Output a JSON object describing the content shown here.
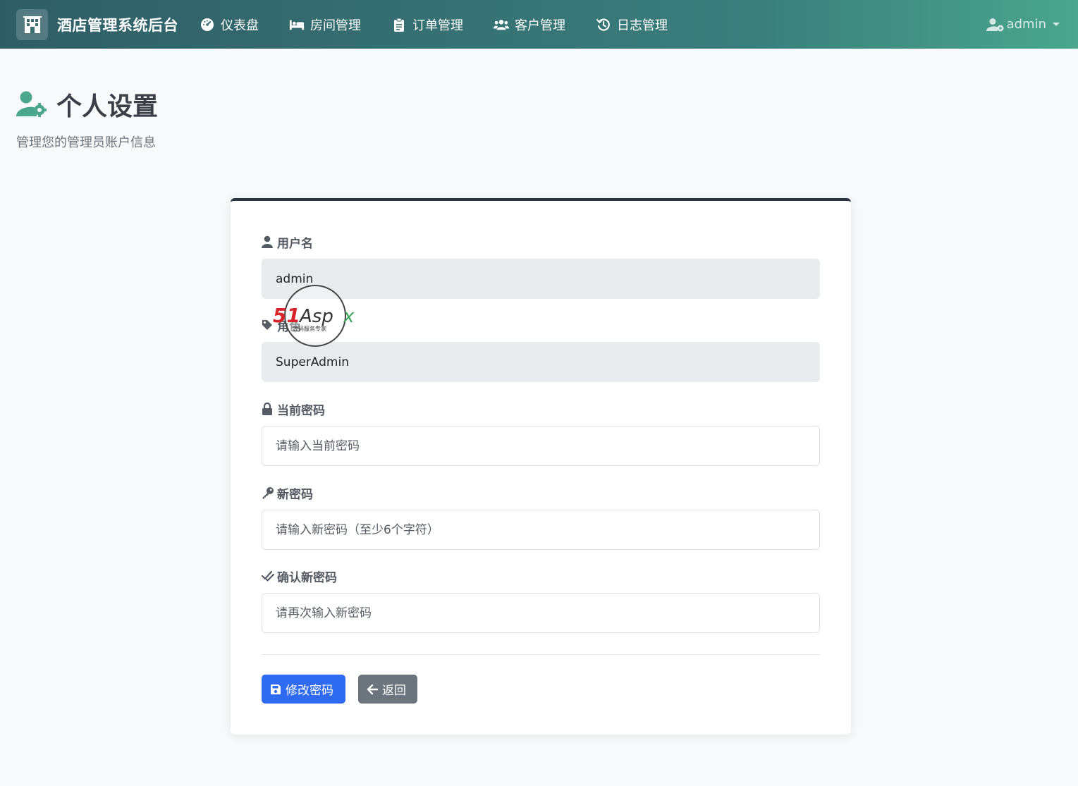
{
  "navbar": {
    "brand_title": "酒店管理系统后台",
    "items": [
      {
        "label": "仪表盘",
        "icon": "gauge-icon"
      },
      {
        "label": "房间管理",
        "icon": "bed-icon"
      },
      {
        "label": "订单管理",
        "icon": "clipboard-icon"
      },
      {
        "label": "客户管理",
        "icon": "users-icon"
      },
      {
        "label": "日志管理",
        "icon": "history-icon"
      }
    ],
    "user_label": "admin"
  },
  "page": {
    "title": "个人设置",
    "subtitle": "管理您的管理员账户信息"
  },
  "form": {
    "username": {
      "label": "用户名",
      "value": "admin"
    },
    "role": {
      "label": "角色",
      "value": "SuperAdmin"
    },
    "current_password": {
      "label": "当前密码",
      "placeholder": "请输入当前密码"
    },
    "new_password": {
      "label": "新密码",
      "placeholder": "请输入新密码（至少6个字符）"
    },
    "confirm_password": {
      "label": "确认新密码",
      "placeholder": "请再次输入新密码"
    },
    "submit_label": "修改密码",
    "back_label": "返回"
  },
  "watermark": {
    "brand": "51Aspx",
    "tagline": "源码服务专家"
  },
  "colors": {
    "primary": "#2f6bf0",
    "secondary": "#6c757d",
    "accent": "#4aa68c",
    "card_top": "#2b3543"
  }
}
